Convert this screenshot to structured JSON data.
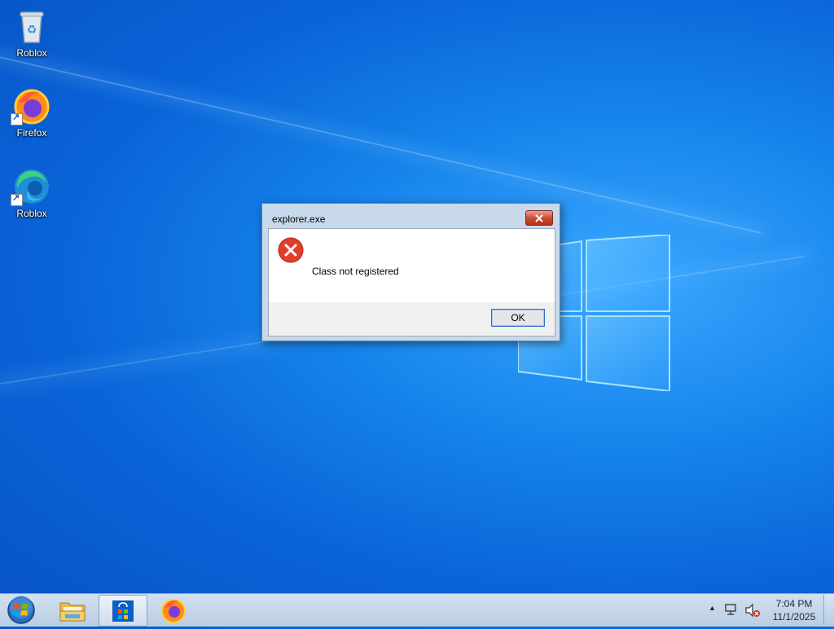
{
  "desktop": {
    "icons": [
      {
        "label": "Roblox",
        "icon": "recycle-bin-icon"
      },
      {
        "label": "Firefox",
        "icon": "firefox-icon"
      },
      {
        "label": "Roblox",
        "icon": "edge-icon"
      }
    ]
  },
  "dialog": {
    "title": "explorer.exe",
    "message": "Class not registered",
    "ok_label": "OK",
    "icon": "error-icon"
  },
  "taskbar": {
    "items": [
      "start-button",
      "file-explorer-icon",
      "microsoft-store-icon",
      "firefox-icon"
    ],
    "clock": {
      "time": "7:04 PM",
      "date": "11/1/2025"
    }
  },
  "colors": {
    "desktop_blue": "#0a63d8",
    "error_red": "#e0402b",
    "taskbar": "#c6d6e8"
  }
}
